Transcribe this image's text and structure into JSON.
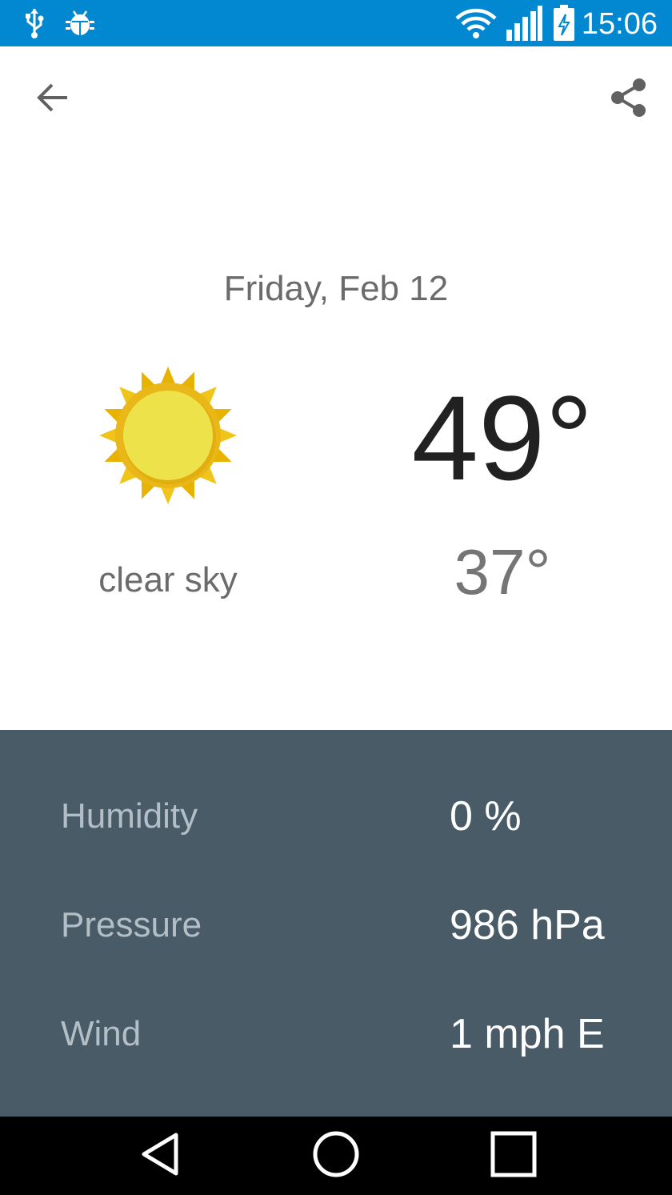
{
  "status_bar": {
    "time": "15:06",
    "icons": [
      "usb-icon",
      "android-debug-icon",
      "wifi-icon",
      "signal-icon",
      "battery-charging-icon"
    ],
    "background": "#0288d1"
  },
  "toolbar": {
    "back_icon": "arrow-back-icon",
    "share_icon": "share-icon"
  },
  "forecast": {
    "date": "Friday, Feb 12",
    "icon": "sun-icon",
    "condition": "clear sky",
    "high": "49°",
    "low": "37°"
  },
  "details": {
    "background": "#485b67",
    "rows": [
      {
        "label": "Humidity",
        "value": "0 %"
      },
      {
        "label": "Pressure",
        "value": "986 hPa"
      },
      {
        "label": "Wind",
        "value": "1 mph E"
      }
    ]
  },
  "nav_bar": {
    "buttons": [
      "back-triangle-icon",
      "home-circle-icon",
      "recents-square-icon"
    ]
  }
}
